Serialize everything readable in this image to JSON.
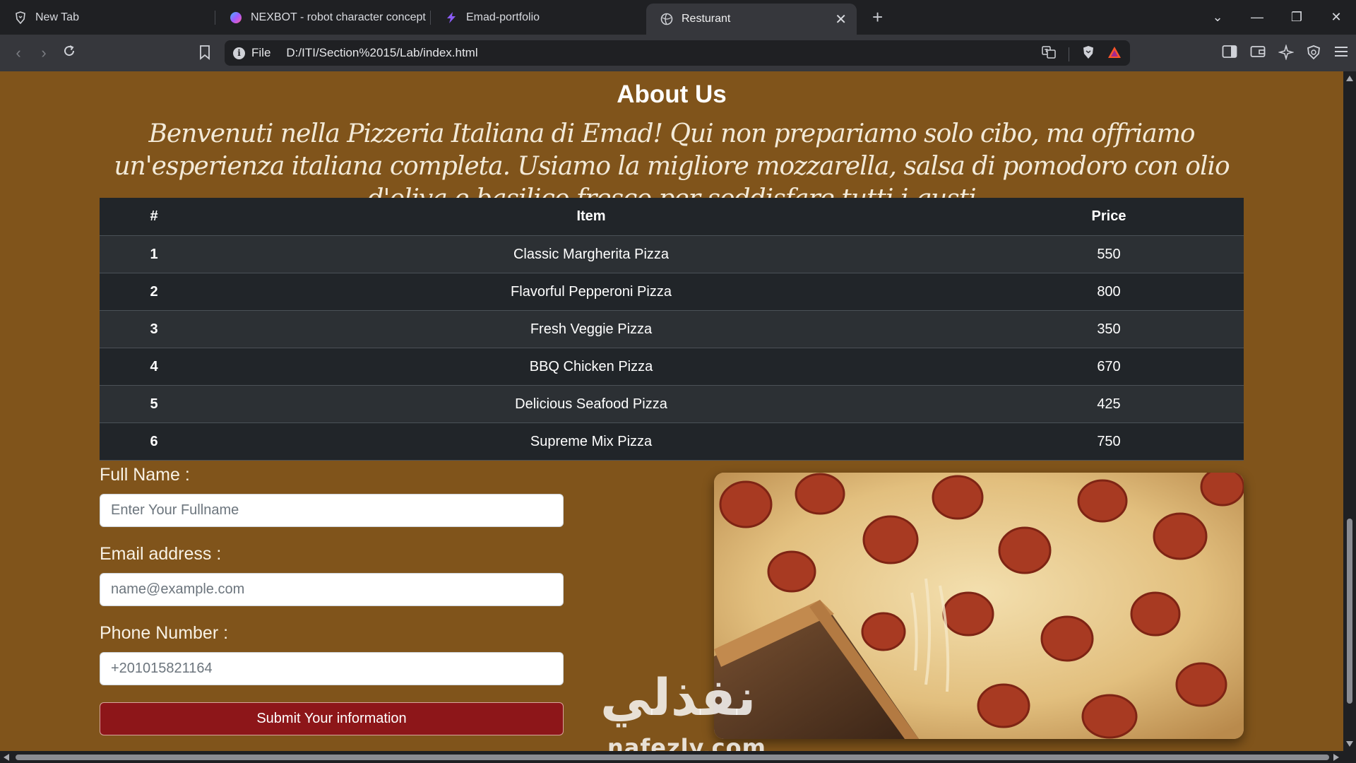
{
  "browser": {
    "tabs": [
      {
        "title": "New Tab",
        "icon": "brave-shield-icon",
        "active": false
      },
      {
        "title": "NEXBOT - robot character concept",
        "icon": "gradient-orb-icon",
        "active": false
      },
      {
        "title": "Emad-portfolio",
        "icon": "lightning-icon",
        "active": false
      },
      {
        "title": "Resturant",
        "icon": "globe-icon",
        "active": true
      }
    ],
    "address": {
      "scheme_label": "File",
      "url": "D:/ITI/Section%2015/Lab/index.html"
    }
  },
  "page": {
    "about_title": "About Us",
    "about_text": "Benvenuti nella Pizzeria Italiana di Emad! Qui non prepariamo solo cibo, ma offriamo un'esperienza italiana completa. Usiamo la migliore mozzarella, salsa di pomodoro con olio d'oliva e basilico fresco per soddisfare tutti i gusti",
    "table": {
      "headers": [
        "#",
        "Item",
        "Price"
      ],
      "rows": [
        {
          "num": "1",
          "item": "Classic Margherita Pizza",
          "price": "550"
        },
        {
          "num": "2",
          "item": "Flavorful Pepperoni Pizza",
          "price": "800"
        },
        {
          "num": "3",
          "item": "Fresh Veggie Pizza",
          "price": "350"
        },
        {
          "num": "4",
          "item": "BBQ Chicken Pizza",
          "price": "670"
        },
        {
          "num": "5",
          "item": "Delicious Seafood Pizza",
          "price": "425"
        },
        {
          "num": "6",
          "item": "Supreme Mix Pizza",
          "price": "750"
        }
      ]
    },
    "form": {
      "fullname_label": "Full Name :",
      "fullname_placeholder": "Enter Your Fullname",
      "email_label": "Email address :",
      "email_placeholder": "name@example.com",
      "phone_label": "Phone Number :",
      "phone_placeholder": "+201015821164",
      "submit_label": "Submit Your information"
    },
    "image_subject": "pepperoni pizza"
  },
  "watermark": {
    "arabic": "نفذلي",
    "latin": "nafezly.com"
  },
  "colors": {
    "page_background": "#80541b",
    "table_dark": "#212529",
    "table_stripe": "#2c3034",
    "submit_button": "#8d1619",
    "browser_chrome": "#1f2023"
  }
}
